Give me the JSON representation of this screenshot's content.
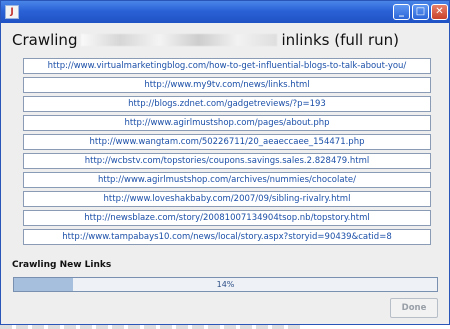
{
  "titlebar": {
    "icon_glyph": "J"
  },
  "window_controls": {
    "minimize": "_",
    "maximize": "□",
    "close": "✕"
  },
  "heading": {
    "prefix": "Crawling",
    "suffix": "inlinks (full run)"
  },
  "links": [
    "http://www.virtualmarketingblog.com/how-to-get-influential-blogs-to-talk-about-you/",
    "http://www.my9tv.com/news/links.html",
    "http://blogs.zdnet.com/gadgetreviews/?p=193",
    "http://www.agirlmustshop.com/pages/about.php",
    "http://www.wangtam.com/50226711/20_aeaeccaee_154471.php",
    "http://wcbstv.com/topstories/coupons.savings.sales.2.828479.html",
    "http://www.agirlmustshop.com/archives/nummies/chocolate/",
    "http://www.loveshakbaby.com/2007/09/sibling-rivalry.html",
    "http://newsblaze.com/story/20081007134904tsop.nb/topstory.html",
    "http://www.tampabays10.com/news/local/story.aspx?storyid=90439&catid=8"
  ],
  "status": {
    "label": "Crawling New Links"
  },
  "progress": {
    "fraction": 0.14,
    "text": "14%"
  },
  "done_button": {
    "label": "Done",
    "enabled": false
  }
}
